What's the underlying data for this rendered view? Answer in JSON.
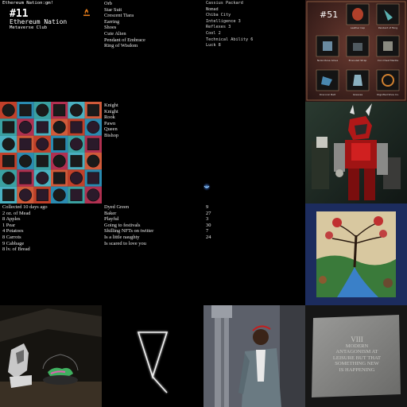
{
  "tiles": {
    "ethereum_nation": {
      "header": "Ethereum Nation:gm!",
      "number": "#11",
      "name": "Ethereum Nation",
      "subtitle": "Metaverse Club"
    },
    "items_list": [
      "Orb",
      "Star Suit",
      "Crescent Tiara",
      "Earring",
      "Shoes",
      "Cute Alien",
      "Pendant of Embrace",
      "Ring of Wisdom"
    ],
    "character_sheet": [
      "Cassius Packard",
      "Nomad",
      "Chiba City",
      "Intelligence 3",
      "Reflexes 3",
      "Cool 2",
      "Technical Ability 6",
      "Luck 8"
    ],
    "loot_card": {
      "number": "#51",
      "items": [
        "Leather Cap",
        "Pendant of Fang",
        "Nolan Rose Glove",
        "Ensouled Strap",
        "Iron Chest Mantle",
        "Draconic Belt",
        "Greaves",
        "Dignified Shoe Co."
      ]
    },
    "chess_pieces": [
      "Knight",
      "Knight",
      "Rook",
      "Pawn",
      "Queen",
      "Bishop"
    ],
    "farm_log": [
      "Collected 10 days ago",
      "2 oz. of Mead",
      "8 Apples",
      "1 Pear",
      "4 Potatoes",
      "8 Carrots",
      "9 Cabbage",
      "8 lv. of Bread"
    ],
    "traits": [
      "Dyed Green",
      "Baker",
      "Playful",
      "Going to festivals",
      "Shilling NFTs on twitter",
      "Is a little naughty",
      "Is scared to love you"
    ],
    "numbers": [
      "9",
      "27",
      "3",
      "30",
      "7",
      "24"
    ],
    "stone_tablet": [
      "VIII",
      "MODERN",
      "ANTAGONISM AT",
      "LEISURE BUT THAT",
      "SOMETHING NEW",
      "IS HAPPENING"
    ]
  },
  "colors": {
    "background": "#000000",
    "text": "#e8e8e8",
    "flame": "#e07a1a"
  }
}
